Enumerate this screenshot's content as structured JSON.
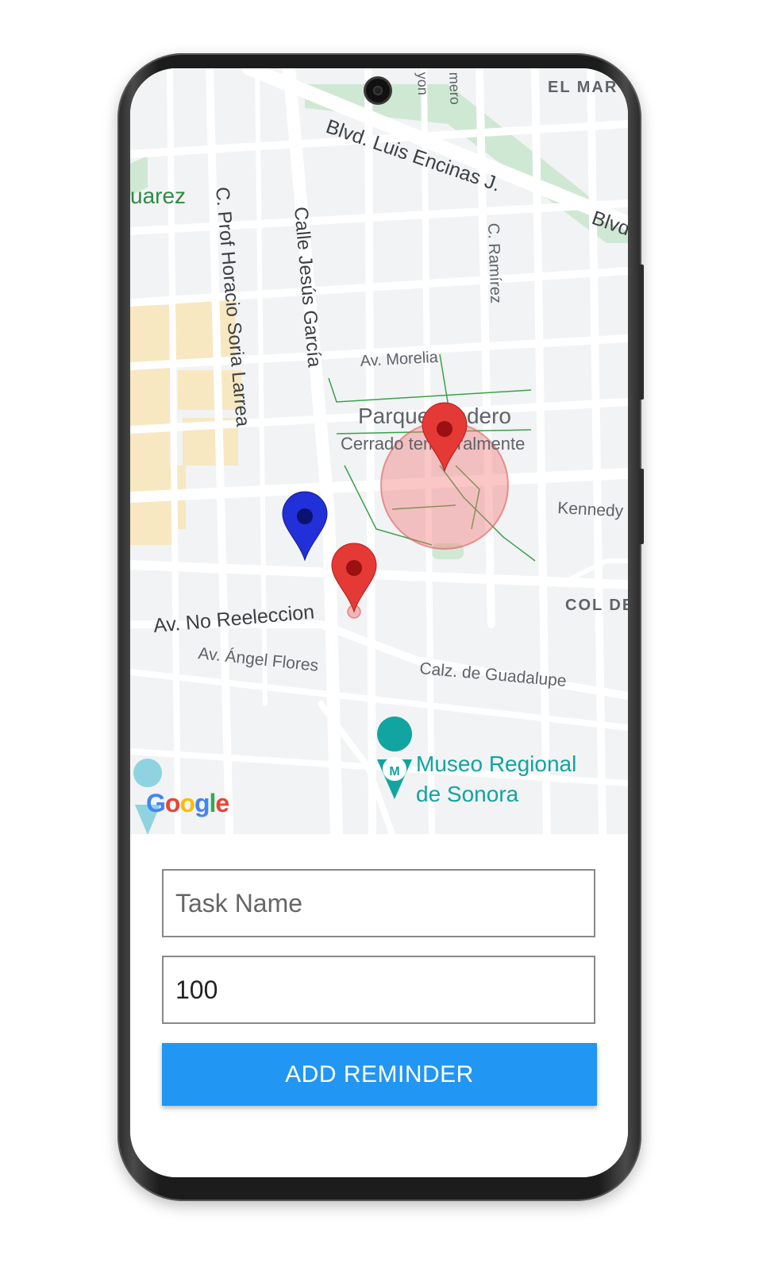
{
  "map": {
    "street_labels": [
      "EL MAR",
      "Blvd. Luis Encinas J.",
      "Blvd",
      "uarez",
      "C. Prof Horacio Soria Larrea",
      "Calle Jesús García",
      "C. Ramírez",
      "Av. Morelia",
      "Parque Madero",
      "Cerrado temporalmente",
      "Kennedy",
      "COL DE",
      "Av. No Reeleccion",
      "Av. Ángel Flores",
      "Calz. de Guadalupe",
      "Museo Regional",
      "de Sonora",
      "yon",
      "mero"
    ],
    "attribution": "Google",
    "colors": {
      "background": "#f1f3f4",
      "road": "#ffffff",
      "park": "#cde9d0",
      "zone": "#f7e8c2",
      "marker_red": "#e53935",
      "marker_blue": "#2130d8",
      "geofence": "#f28b82",
      "poi": "#12a4a0"
    },
    "markers": [
      {
        "name": "red-marker-park",
        "color": "#e53935"
      },
      {
        "name": "blue-marker",
        "color": "#2130d8"
      },
      {
        "name": "red-marker-street",
        "color": "#e53935"
      }
    ]
  },
  "form": {
    "task_name_placeholder": "Task Name",
    "task_name_value": "",
    "radius_value": "100",
    "add_button_label": "ADD REMINDER",
    "accent_color": "#2196f3"
  }
}
